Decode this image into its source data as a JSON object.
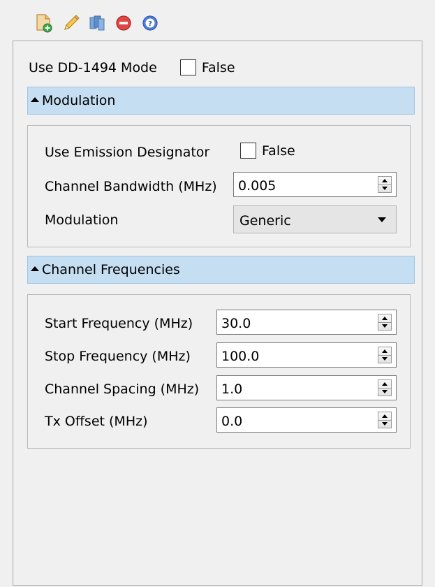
{
  "toolbar": {
    "icons": [
      "add-document-icon",
      "edit-pencil-icon",
      "copy-icon",
      "delete-icon",
      "help-icon"
    ]
  },
  "dd1494": {
    "label": "Use DD-1494 Mode",
    "checked": false,
    "value_text": "False"
  },
  "modulation_section": {
    "header": "Modulation",
    "emission_designator": {
      "label": "Use Emission Designator",
      "checked": false,
      "value_text": "False"
    },
    "channel_bandwidth": {
      "label": "Channel Bandwidth (MHz)",
      "value": "0.005"
    },
    "modulation": {
      "label": "Modulation",
      "selected": "Generic"
    }
  },
  "frequencies_section": {
    "header": "Channel Frequencies",
    "start_frequency": {
      "label": "Start Frequency (MHz)",
      "value": "30.0"
    },
    "stop_frequency": {
      "label": "Stop Frequency (MHz)",
      "value": "100.0"
    },
    "channel_spacing": {
      "label": "Channel Spacing (MHz)",
      "value": "1.0"
    },
    "tx_offset": {
      "label": "Tx Offset (MHz)",
      "value": "0.0"
    }
  },
  "colors": {
    "section_header_bg": "#c5def2",
    "panel_bg": "#f0f0f0"
  }
}
